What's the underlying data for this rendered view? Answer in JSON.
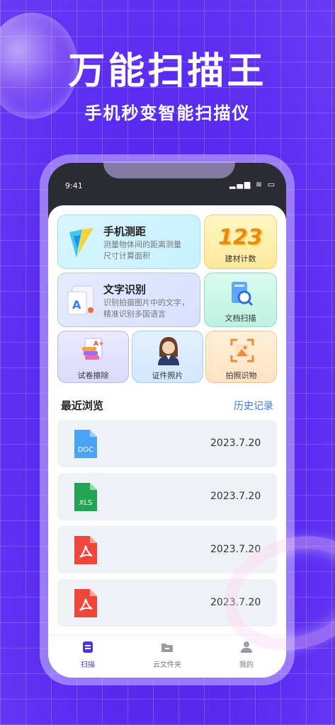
{
  "promo": {
    "headline": "万能扫描王",
    "subline": "手机秒变智能扫描仪"
  },
  "status_bar": {
    "time": "9:41",
    "icons": "▂▄▆ ≋ ▭"
  },
  "features": {
    "measure": {
      "title": "手机测距",
      "desc": "测量物体间的距离测量尺寸计算面积"
    },
    "count": {
      "number": "123",
      "label": "建材计数"
    },
    "text_recognition": {
      "title": "文字识别",
      "desc": "识别拍摄图片中的文字，精准识别多国语言"
    },
    "doc_scan": {
      "label": "文档扫描"
    },
    "exam_erase": {
      "label": "试卷擦除"
    },
    "id_photo": {
      "label": "证件照片"
    },
    "photo_recognize": {
      "label": "拍照识物"
    }
  },
  "recent": {
    "title": "最近浏览",
    "history_link": "历史记录",
    "items": [
      {
        "type": "DOC",
        "date": "2023.7.20",
        "color": "#4aa3f5"
      },
      {
        "type": "XLS",
        "date": "2023.7.20",
        "color": "#23a455"
      },
      {
        "type": "PDF",
        "date": "2023.7.20",
        "color": "#f0473a"
      },
      {
        "type": "PDF",
        "date": "2023.7.20",
        "color": "#f0473a"
      }
    ]
  },
  "tabbar": {
    "scan": "扫描",
    "cloud": "云文件夹",
    "mine": "我的"
  },
  "colors": {
    "accent": "#4a33e0",
    "link": "#3e7bf0",
    "background": "#5a2cf0"
  }
}
